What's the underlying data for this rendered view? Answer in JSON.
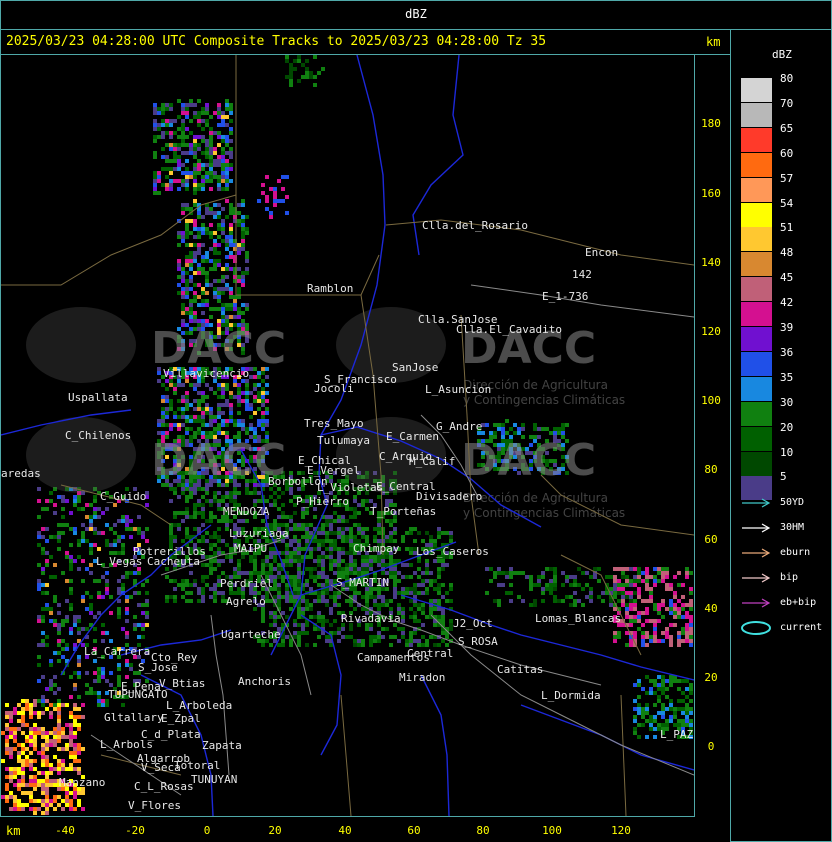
{
  "header": {
    "title": "dBZ"
  },
  "map_title": {
    "text": "2025/03/23 04:28:00 UTC Composite Tracks to 2025/03/23 04:28:00 Tz 35",
    "unit_top": "km",
    "unit_bottom": "km"
  },
  "legend": {
    "title": "dBZ",
    "levels": [
      {
        "label": "80",
        "color": "#d4d4d4"
      },
      {
        "label": "70",
        "color": "#b8b8b8"
      },
      {
        "label": "65",
        "color": "#ff3a2a"
      },
      {
        "label": "60",
        "color": "#ff6a10"
      },
      {
        "label": "57",
        "color": "#ff9858"
      },
      {
        "label": "54",
        "color": "#ffff00"
      },
      {
        "label": "51",
        "color": "#ffc830"
      },
      {
        "label": "48",
        "color": "#d88830"
      },
      {
        "label": "45",
        "color": "#c06078"
      },
      {
        "label": "42",
        "color": "#d41090"
      },
      {
        "label": "39",
        "color": "#7010d0"
      },
      {
        "label": "36",
        "color": "#2050e8"
      },
      {
        "label": "35",
        "color": "#1888e0"
      },
      {
        "label": "30",
        "color": "#108010"
      },
      {
        "label": "20",
        "color": "#006000"
      },
      {
        "label": "10",
        "color": "#004800"
      },
      {
        "label": "5",
        "color": "#4a3c88"
      }
    ],
    "tracks": [
      {
        "label": "50YD",
        "color": "#40c8c8",
        "icon": "arrow-icon"
      },
      {
        "label": "30HM",
        "color": "#ffffff",
        "icon": "arrow-icon"
      },
      {
        "label": "eburn",
        "color": "#e8a878",
        "icon": "arrow-icon"
      },
      {
        "label": "bip",
        "color": "#f0c8c8",
        "icon": "arrow-icon"
      },
      {
        "label": "eb+bip",
        "color": "#c040c0",
        "icon": "arrow-icon"
      },
      {
        "label": "current",
        "color": "#40e0e0",
        "icon": "ellipse-icon"
      }
    ]
  },
  "axes": {
    "x_ticks": [
      "-40",
      "-20",
      "0",
      "20",
      "40",
      "60",
      "80",
      "100",
      "120"
    ],
    "y_ticks": [
      "180",
      "160",
      "140",
      "120",
      "100",
      "80",
      "60",
      "40",
      "20",
      "0"
    ]
  },
  "watermark": {
    "brand": "DACC",
    "subtitle_line1": "Dirección de Agricultura",
    "subtitle_line2": "y Contingencias Climáticas"
  },
  "places": [
    {
      "name": "Clla.del_Rosario"
    },
    {
      "name": "Encon"
    },
    {
      "name": "142"
    },
    {
      "name": "E_1-736"
    },
    {
      "name": "Ramblon"
    },
    {
      "name": "Clla.SanJose"
    },
    {
      "name": "Clla.El_Cavadito"
    },
    {
      "name": "S_Francisco"
    },
    {
      "name": "SanJose"
    },
    {
      "name": "Jocoli"
    },
    {
      "name": "L_Asuncion"
    },
    {
      "name": "Villavicencio"
    },
    {
      "name": "Uspallata"
    },
    {
      "name": "C_Chilenos"
    },
    {
      "name": "Tres_Mayo"
    },
    {
      "name": "Tulumaya"
    },
    {
      "name": "E_Carmen"
    },
    {
      "name": "G_Andre"
    },
    {
      "name": "C_Arquio"
    },
    {
      "name": "M_Calif"
    },
    {
      "name": "E_Chical"
    },
    {
      "name": "E_Vergel"
    },
    {
      "name": "Borbollon"
    },
    {
      "name": "L_Violetas"
    },
    {
      "name": "E_Central"
    },
    {
      "name": "Divisadero"
    },
    {
      "name": "P_Hierro"
    },
    {
      "name": "T_Porteñas"
    },
    {
      "name": "C_Guido"
    },
    {
      "name": "Potrerillos"
    },
    {
      "name": "Cacheuta"
    },
    {
      "name": "L_Vegas"
    },
    {
      "name": "MENDOZA"
    },
    {
      "name": "Luzuriaga"
    },
    {
      "name": "MAIPU"
    },
    {
      "name": "Perdriel"
    },
    {
      "name": "Agrelo"
    },
    {
      "name": "Chimpay"
    },
    {
      "name": "Los_Caseros"
    },
    {
      "name": "S_MARTIN"
    },
    {
      "name": "Ugarteche"
    },
    {
      "name": "J2_Oct"
    },
    {
      "name": "S_ROSA"
    },
    {
      "name": "Lomas_Blancas"
    },
    {
      "name": "La_Carrera"
    },
    {
      "name": "Cto_Rey"
    },
    {
      "name": "S_Jose"
    },
    {
      "name": "V_Btias"
    },
    {
      "name": "Anchoris"
    },
    {
      "name": "Campamentos"
    },
    {
      "name": "Central"
    },
    {
      "name": "Catitas"
    },
    {
      "name": "E_Pena"
    },
    {
      "name": "TUPUNGATO"
    },
    {
      "name": "L_Arboleda"
    },
    {
      "name": "Miradon"
    },
    {
      "name": "L_Dormida"
    },
    {
      "name": "Gltallary"
    },
    {
      "name": "E_Zpal"
    },
    {
      "name": "C_d_Plata"
    },
    {
      "name": "Zapata"
    },
    {
      "name": "L_Arbols"
    },
    {
      "name": "Algarrob"
    },
    {
      "name": "V_Seca"
    },
    {
      "name": "Totoral"
    },
    {
      "name": "TUNUYAN"
    },
    {
      "name": "Manzano"
    },
    {
      "name": "C_L_Rosas"
    },
    {
      "name": "V_Flores"
    },
    {
      "name": "L_PAZ"
    },
    {
      "name": "aredas"
    },
    {
      "name": "Rivadavia"
    }
  ]
}
